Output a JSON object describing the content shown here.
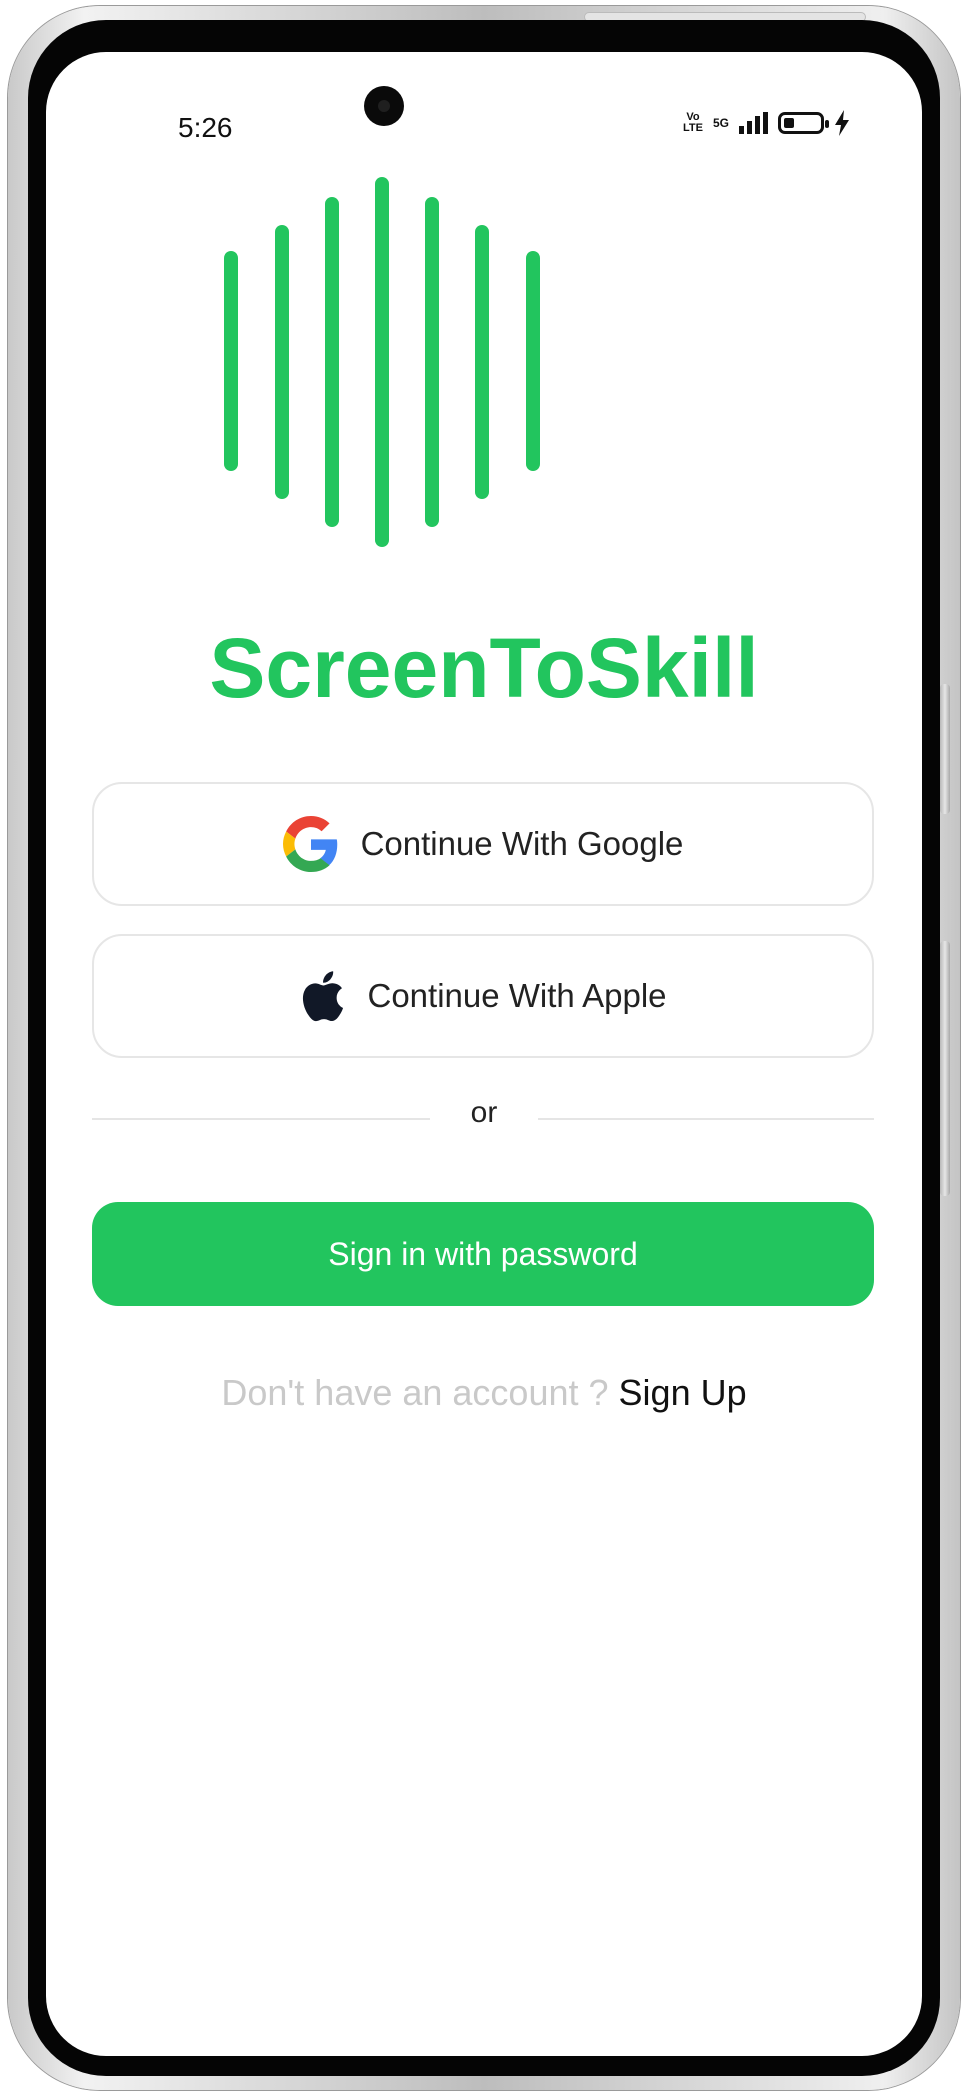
{
  "status_bar": {
    "time": "5:26",
    "volte_line1": "Vo",
    "volte_line2": "LTE",
    "network": "5G"
  },
  "brand": {
    "name": "ScreenToSkill",
    "color": "#22c55e"
  },
  "auth": {
    "google_label": "Continue With Google",
    "apple_label": "Continue With Apple",
    "divider_text": "or",
    "password_label": "Sign in with password"
  },
  "signup": {
    "prompt": "Don't have an account ?",
    "link": "Sign Up"
  },
  "icons": {
    "google": "google-g-logo",
    "apple": "apple-logo",
    "battery": "battery-icon",
    "charging": "bolt-icon",
    "signal": "signal-bars-icon"
  }
}
